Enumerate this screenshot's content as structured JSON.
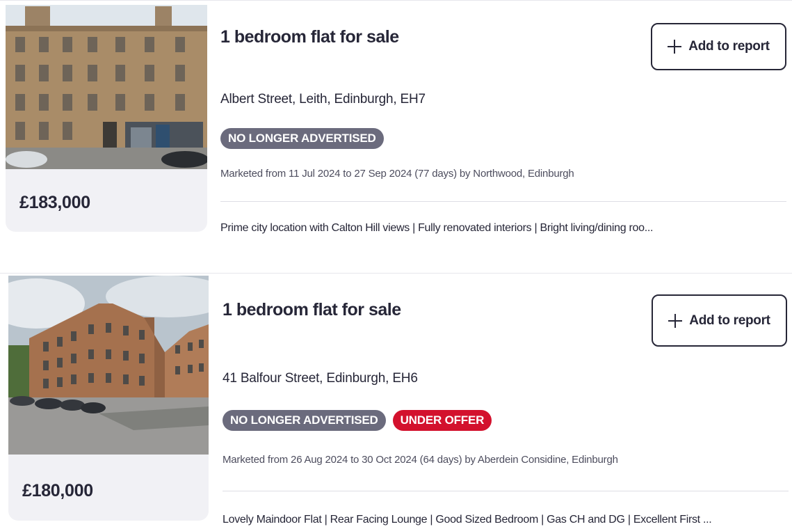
{
  "listings": [
    {
      "price": "£183,000",
      "title": "1 bedroom flat for sale",
      "add_label": "Add to report",
      "address": "Albert Street, Leith, Edinburgh, EH7",
      "badges": [
        "NO LONGER ADVERTISED"
      ],
      "marketed": "Marketed from 11 Jul 2024 to 27 Sep 2024 (77 days) by Northwood, Edinburgh",
      "features": "Prime city location with Calton Hill views | Fully renovated interiors | Bright living/dining roo..."
    },
    {
      "price": "£180,000",
      "title": "1 bedroom flat for sale",
      "add_label": "Add to report",
      "address": "41 Balfour Street, Edinburgh, EH6",
      "badges": [
        "NO LONGER ADVERTISED",
        "UNDER OFFER"
      ],
      "marketed": "Marketed from 26 Aug 2024 to 30 Oct 2024 (64 days) by Aberdein Considine, Edinburgh",
      "features": "Lovely Maindoor Flat | Rear Facing Lounge | Good Sized Bedroom | Gas CH and DG | Excellent First ..."
    }
  ],
  "icons": {
    "add": "plus-icon"
  },
  "colors": {
    "badge_grey": "#6b6b7d",
    "badge_red": "#d3112d",
    "text": "#262637"
  }
}
